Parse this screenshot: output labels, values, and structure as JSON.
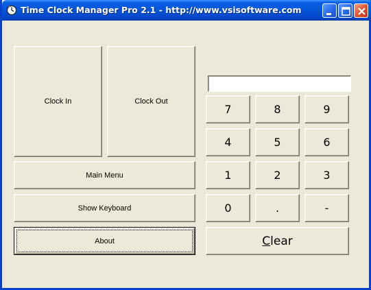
{
  "window": {
    "title": "Time Clock Manager Pro 2.1 - http://www.vsisoftware.com"
  },
  "buttons": {
    "clock_in": "Clock In",
    "clock_out": "Clock Out",
    "main_menu": "Main Menu",
    "show_keyboard": "Show Keyboard",
    "about": "About"
  },
  "keypad": {
    "entry_value": "",
    "keys": [
      "7",
      "8",
      "9",
      "4",
      "5",
      "6",
      "1",
      "2",
      "3",
      "0",
      ".",
      "-"
    ],
    "clear_first": "C",
    "clear_rest": "lear"
  },
  "colors": {
    "titlebar": "#0455d8",
    "face": "#ece9d8"
  }
}
